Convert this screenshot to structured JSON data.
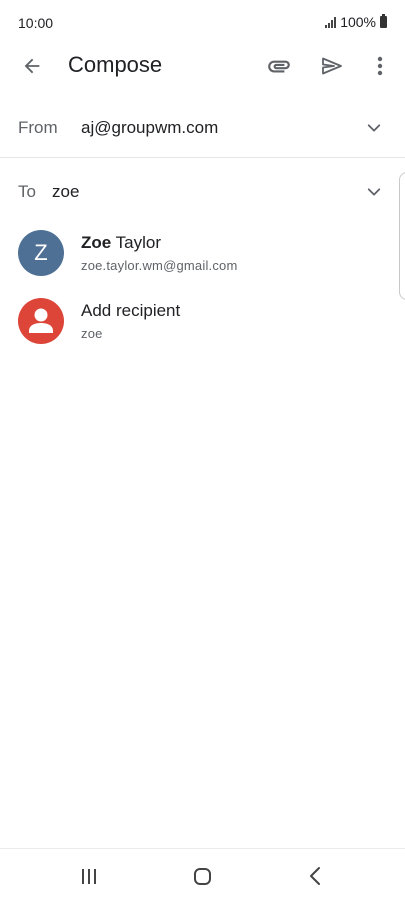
{
  "status_bar": {
    "time": "10:00",
    "battery": "100%"
  },
  "app_bar": {
    "title": "Compose"
  },
  "from": {
    "label": "From",
    "value": "aj@groupwm.com"
  },
  "to": {
    "label": "To",
    "value": "zoe"
  },
  "suggestions": [
    {
      "avatar_letter": "Z",
      "name_bold": "Zoe",
      "name_rest": " Taylor",
      "sub": "zoe.taylor.wm@gmail.com",
      "avatar_color": "#4e7095"
    },
    {
      "name": "Add recipient",
      "sub": "zoe",
      "avatar_color": "#dd4538",
      "icon": "person-icon"
    }
  ],
  "icons": {
    "back": "arrow-left-icon",
    "attach": "paperclip-icon",
    "send": "send-icon",
    "more": "more-vert-icon",
    "chevron": "chevron-down-icon"
  },
  "colors": {
    "accent": "#4e7095",
    "add_recipient": "#dd4538"
  }
}
